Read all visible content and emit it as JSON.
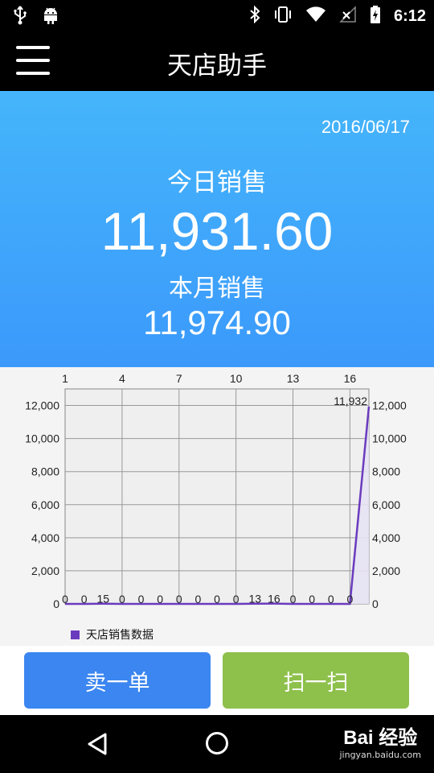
{
  "status_bar": {
    "left_icons": [
      "usb-icon",
      "android-icon"
    ],
    "right_icons": [
      "bluetooth-icon",
      "vibrate-icon",
      "wifi-icon",
      "no-signal-icon",
      "battery-charging-icon"
    ],
    "time": "6:12"
  },
  "app_bar": {
    "title": "天店助手",
    "menu_icon": "hamburger-menu-icon"
  },
  "summary": {
    "date": "2016/06/17",
    "today_label": "今日销售",
    "today_value": "11,931.60",
    "month_label": "本月销售",
    "month_value": "11,974.90"
  },
  "chart_data": {
    "type": "line",
    "x": [
      1,
      2,
      3,
      4,
      5,
      6,
      7,
      8,
      9,
      10,
      11,
      12,
      13,
      14,
      15,
      16,
      17
    ],
    "x_tick_labels": [
      "1",
      "4",
      "7",
      "10",
      "13",
      "16"
    ],
    "x_tick_values": [
      1,
      4,
      7,
      10,
      13,
      16
    ],
    "series": [
      {
        "name": "天店销售数据",
        "values": [
          0,
          0,
          15,
          0,
          0,
          0,
          0,
          0,
          0,
          0,
          13,
          16,
          0,
          0,
          0,
          0,
          11932
        ],
        "point_labels": [
          "0",
          "0",
          "15",
          "0",
          "0",
          "0",
          "0",
          "0",
          "0",
          "0",
          "13",
          "16",
          "0",
          "0",
          "0",
          "0",
          "11,932"
        ],
        "color": "#6a3bbe",
        "fill": "#e6e2f3"
      }
    ],
    "ylim": [
      0,
      13000
    ],
    "y_tick_values": [
      0,
      2000,
      4000,
      6000,
      8000,
      10000,
      12000
    ],
    "y_tick_labels": [
      "0",
      "2,000",
      "4,000",
      "6,000",
      "8,000",
      "10,000",
      "12,000"
    ],
    "secondary_y_axis": true,
    "grid": true,
    "legend_position": "bottom-left"
  },
  "legend": {
    "label": "天店销售数据",
    "color": "#6a3bbe"
  },
  "actions": {
    "sell_label": "卖一单",
    "sell_color": "#3b86f0",
    "scan_label": "扫一扫",
    "scan_color": "#8ec04c"
  },
  "nav_bar": {
    "back_icon": "back-triangle-icon",
    "home_icon": "home-circle-icon"
  },
  "watermark": {
    "main": "Bai 经验",
    "sub": "jingyan.baidu.com"
  }
}
